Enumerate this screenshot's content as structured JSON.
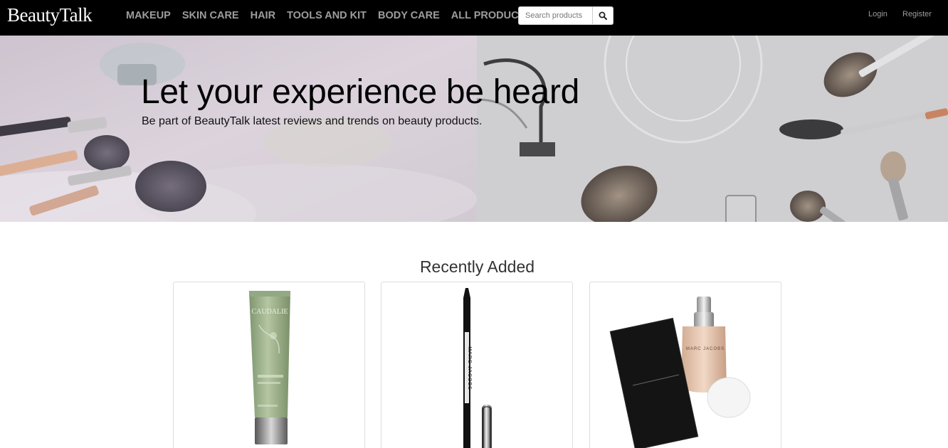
{
  "brand": "BeautyTalk",
  "nav": [
    {
      "label": "MAKEUP"
    },
    {
      "label": "SKIN CARE"
    },
    {
      "label": "HAIR"
    },
    {
      "label": "TOOLS AND KIT"
    },
    {
      "label": "BODY CARE"
    },
    {
      "label": "ALL PRODUCTS"
    }
  ],
  "search": {
    "placeholder": "Search products",
    "icon": "search-icon"
  },
  "auth": {
    "login": "Login",
    "register": "Register"
  },
  "hero": {
    "title": "Let your experience be heard",
    "subtitle": "Be part of BeautyTalk latest reviews and trends on beauty products."
  },
  "recent": {
    "title": "Recently Added",
    "products": [
      {
        "brand_text": "CAUDALIE",
        "image": "caudalie-cream-tube"
      },
      {
        "brand_text": "MARC JACOBS",
        "image": "marc-jacobs-eyeliner"
      },
      {
        "brand_text": "MARC JACOBS",
        "image": "marc-jacobs-foundation"
      }
    ]
  },
  "colors": {
    "navbar": "#000000",
    "nav_link": "#9d9d9d",
    "page": "#ffffff"
  }
}
